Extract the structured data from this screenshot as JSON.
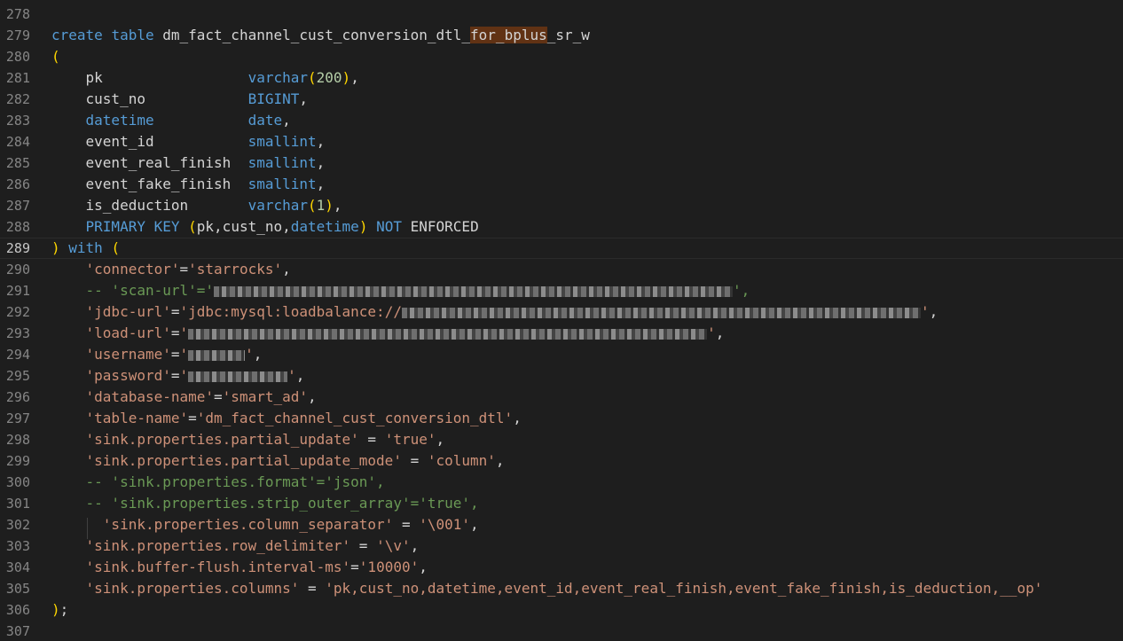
{
  "editor": {
    "lines": [
      {
        "num": "278",
        "tokens": []
      },
      {
        "num": "279",
        "tokens": [
          {
            "c": "kw",
            "t": "create"
          },
          {
            "c": "txt",
            "t": " "
          },
          {
            "c": "kw",
            "t": "table"
          },
          {
            "c": "txt",
            "t": " dm_fact_channel_cust_conversion_dtl_"
          },
          {
            "c": "txt hl",
            "t": "for_bplus"
          },
          {
            "c": "txt",
            "t": "_sr_w"
          }
        ]
      },
      {
        "num": "280",
        "tokens": [
          {
            "c": "br",
            "t": "("
          }
        ]
      },
      {
        "num": "281",
        "tokens": [
          {
            "c": "txt",
            "t": "    pk                 "
          },
          {
            "c": "kw",
            "t": "varchar"
          },
          {
            "c": "br",
            "t": "("
          },
          {
            "c": "num",
            "t": "200"
          },
          {
            "c": "br",
            "t": ")"
          },
          {
            "c": "txt",
            "t": ","
          }
        ]
      },
      {
        "num": "282",
        "tokens": [
          {
            "c": "txt",
            "t": "    cust_no            "
          },
          {
            "c": "kw",
            "t": "BIGINT"
          },
          {
            "c": "txt",
            "t": ","
          }
        ]
      },
      {
        "num": "283",
        "tokens": [
          {
            "c": "txt",
            "t": "    "
          },
          {
            "c": "kw",
            "t": "datetime"
          },
          {
            "c": "txt",
            "t": "           "
          },
          {
            "c": "kw",
            "t": "date"
          },
          {
            "c": "txt",
            "t": ","
          }
        ]
      },
      {
        "num": "284",
        "tokens": [
          {
            "c": "txt",
            "t": "    event_id           "
          },
          {
            "c": "kw",
            "t": "smallint"
          },
          {
            "c": "txt",
            "t": ","
          }
        ]
      },
      {
        "num": "285",
        "tokens": [
          {
            "c": "txt",
            "t": "    event_real_finish  "
          },
          {
            "c": "kw",
            "t": "smallint"
          },
          {
            "c": "txt",
            "t": ","
          }
        ]
      },
      {
        "num": "286",
        "tokens": [
          {
            "c": "txt",
            "t": "    event_fake_finish  "
          },
          {
            "c": "kw",
            "t": "smallint"
          },
          {
            "c": "txt",
            "t": ","
          }
        ]
      },
      {
        "num": "287",
        "tokens": [
          {
            "c": "txt",
            "t": "    is_deduction       "
          },
          {
            "c": "kw",
            "t": "varchar"
          },
          {
            "c": "br",
            "t": "("
          },
          {
            "c": "num",
            "t": "1"
          },
          {
            "c": "br",
            "t": ")"
          },
          {
            "c": "txt",
            "t": ","
          }
        ]
      },
      {
        "num": "288",
        "tokens": [
          {
            "c": "txt",
            "t": "    "
          },
          {
            "c": "kw",
            "t": "PRIMARY KEY"
          },
          {
            "c": "txt",
            "t": " "
          },
          {
            "c": "br",
            "t": "("
          },
          {
            "c": "txt",
            "t": "pk,cust_no,"
          },
          {
            "c": "kw",
            "t": "datetime"
          },
          {
            "c": "br",
            "t": ")"
          },
          {
            "c": "txt",
            "t": " "
          },
          {
            "c": "kw",
            "t": "NOT"
          },
          {
            "c": "txt",
            "t": " ENFORCED"
          }
        ]
      },
      {
        "num": "289",
        "current": true,
        "tokens": [
          {
            "c": "br",
            "t": ")"
          },
          {
            "c": "txt",
            "t": " "
          },
          {
            "c": "kw",
            "t": "with"
          },
          {
            "c": "txt",
            "t": " "
          },
          {
            "c": "br",
            "t": "("
          }
        ]
      },
      {
        "num": "290",
        "tokens": [
          {
            "c": "txt",
            "t": "    "
          },
          {
            "c": "str",
            "t": "'connector'"
          },
          {
            "c": "txt",
            "t": "="
          },
          {
            "c": "str",
            "t": "'starrocks'"
          },
          {
            "c": "txt",
            "t": ","
          }
        ]
      },
      {
        "num": "291",
        "tokens": [
          {
            "c": "txt",
            "t": "    "
          },
          {
            "c": "cmt",
            "t": "-- 'scan-url'='"
          },
          {
            "c": "blur",
            "w": 585
          },
          {
            "c": "cmt",
            "t": "',"
          }
        ]
      },
      {
        "num": "292",
        "tokens": [
          {
            "c": "txt",
            "t": "    "
          },
          {
            "c": "str",
            "t": "'jdbc-url'"
          },
          {
            "c": "txt",
            "t": "="
          },
          {
            "c": "str",
            "t": "'jdbc:mysql:loadbalance://"
          },
          {
            "c": "blur",
            "w": 585
          },
          {
            "c": "str",
            "t": "'"
          },
          {
            "c": "txt",
            "t": ","
          }
        ]
      },
      {
        "num": "293",
        "tokens": [
          {
            "c": "txt",
            "t": "    "
          },
          {
            "c": "str",
            "t": "'load-url'"
          },
          {
            "c": "txt",
            "t": "="
          },
          {
            "c": "str",
            "t": "'"
          },
          {
            "c": "blur",
            "w": 585
          },
          {
            "c": "str",
            "t": "'"
          },
          {
            "c": "txt",
            "t": ","
          }
        ]
      },
      {
        "num": "294",
        "tokens": [
          {
            "c": "txt",
            "t": "    "
          },
          {
            "c": "str",
            "t": "'username'"
          },
          {
            "c": "txt",
            "t": "="
          },
          {
            "c": "str",
            "t": "'"
          },
          {
            "c": "blur",
            "w": 64
          },
          {
            "c": "str",
            "t": "'"
          },
          {
            "c": "txt",
            "t": ","
          }
        ]
      },
      {
        "num": "295",
        "tokens": [
          {
            "c": "txt",
            "t": "    "
          },
          {
            "c": "str",
            "t": "'password'"
          },
          {
            "c": "txt",
            "t": "="
          },
          {
            "c": "str",
            "t": "'"
          },
          {
            "c": "blur",
            "w": 112
          },
          {
            "c": "str",
            "t": "'"
          },
          {
            "c": "txt",
            "t": ","
          }
        ]
      },
      {
        "num": "296",
        "tokens": [
          {
            "c": "txt",
            "t": "    "
          },
          {
            "c": "str",
            "t": "'database-name'"
          },
          {
            "c": "txt",
            "t": "="
          },
          {
            "c": "str",
            "t": "'smart_ad'"
          },
          {
            "c": "txt",
            "t": ","
          }
        ]
      },
      {
        "num": "297",
        "tokens": [
          {
            "c": "txt",
            "t": "    "
          },
          {
            "c": "str",
            "t": "'table-name'"
          },
          {
            "c": "txt",
            "t": "="
          },
          {
            "c": "str",
            "t": "'dm_fact_channel_cust_conversion_dtl'"
          },
          {
            "c": "txt",
            "t": ","
          }
        ]
      },
      {
        "num": "298",
        "tokens": [
          {
            "c": "txt",
            "t": "    "
          },
          {
            "c": "str",
            "t": "'sink.properties.partial_update'"
          },
          {
            "c": "txt",
            "t": " = "
          },
          {
            "c": "str",
            "t": "'true'"
          },
          {
            "c": "txt",
            "t": ","
          }
        ]
      },
      {
        "num": "299",
        "tokens": [
          {
            "c": "txt",
            "t": "    "
          },
          {
            "c": "str",
            "t": "'sink.properties.partial_update_mode'"
          },
          {
            "c": "txt",
            "t": " = "
          },
          {
            "c": "str",
            "t": "'column'"
          },
          {
            "c": "txt",
            "t": ","
          }
        ]
      },
      {
        "num": "300",
        "tokens": [
          {
            "c": "txt",
            "t": "    "
          },
          {
            "c": "cmt",
            "t": "-- 'sink.properties.format'='json',"
          }
        ]
      },
      {
        "num": "301",
        "tokens": [
          {
            "c": "txt",
            "t": "    "
          },
          {
            "c": "cmt",
            "t": "-- 'sink.properties.strip_outer_array'='true',"
          }
        ]
      },
      {
        "num": "302",
        "tokens": [
          {
            "c": "txt",
            "t": "      "
          },
          {
            "c": "str",
            "t": "'sink.properties.column_separator'"
          },
          {
            "c": "txt",
            "t": " = "
          },
          {
            "c": "str",
            "t": "'\\001'"
          },
          {
            "c": "txt",
            "t": ","
          }
        ]
      },
      {
        "num": "303",
        "tokens": [
          {
            "c": "txt",
            "t": "    "
          },
          {
            "c": "str",
            "t": "'sink.properties.row_delimiter'"
          },
          {
            "c": "txt",
            "t": " = "
          },
          {
            "c": "str",
            "t": "'\\v'"
          },
          {
            "c": "txt",
            "t": ","
          }
        ]
      },
      {
        "num": "304",
        "tokens": [
          {
            "c": "txt",
            "t": "    "
          },
          {
            "c": "str",
            "t": "'sink.buffer-flush.interval-ms'"
          },
          {
            "c": "txt",
            "t": "="
          },
          {
            "c": "str",
            "t": "'10000'"
          },
          {
            "c": "txt",
            "t": ","
          }
        ]
      },
      {
        "num": "305",
        "tokens": [
          {
            "c": "txt",
            "t": "    "
          },
          {
            "c": "str",
            "t": "'sink.properties.columns'"
          },
          {
            "c": "txt",
            "t": " = "
          },
          {
            "c": "str",
            "t": "'pk,cust_no,datetime,event_id,event_real_finish,event_fake_finish,is_deduction,__op'"
          }
        ]
      },
      {
        "num": "306",
        "tokens": [
          {
            "c": "br",
            "t": ")"
          },
          {
            "c": "txt",
            "t": ";"
          }
        ]
      },
      {
        "num": "307",
        "tokens": []
      }
    ]
  }
}
